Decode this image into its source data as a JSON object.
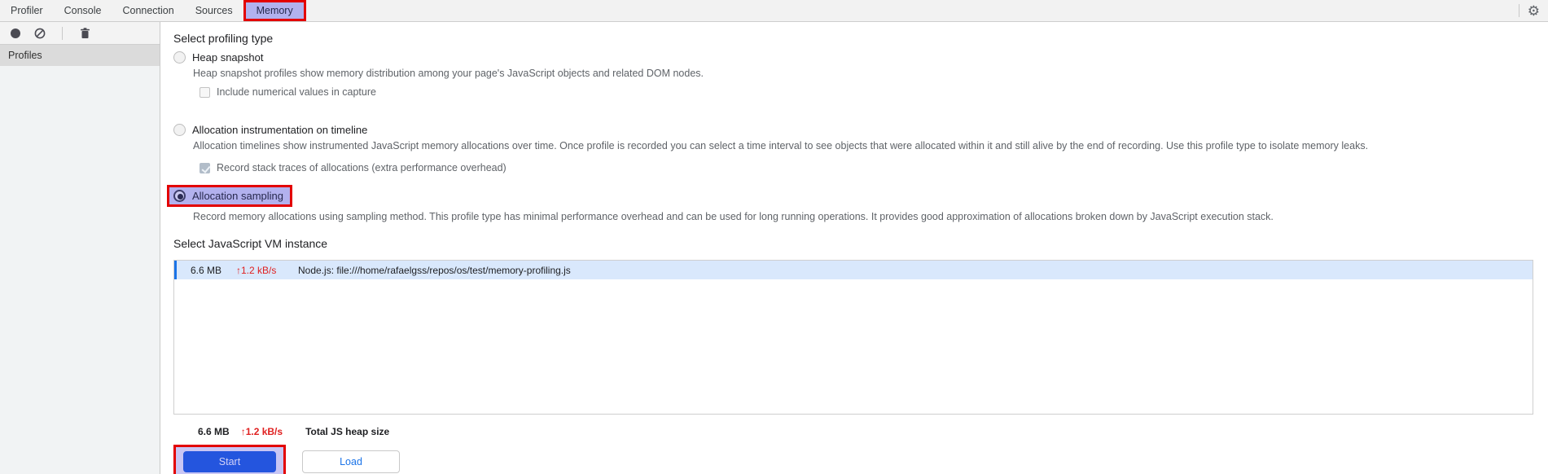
{
  "tabs": {
    "items": [
      {
        "label": "Profiler"
      },
      {
        "label": "Console"
      },
      {
        "label": "Connection"
      },
      {
        "label": "Sources"
      },
      {
        "label": "Memory",
        "selected": true,
        "annotated": true
      }
    ]
  },
  "sidebar": {
    "header": "Profiles"
  },
  "profiling": {
    "heading": "Select profiling type",
    "types": [
      {
        "label": "Heap snapshot",
        "selected": false,
        "description": "Heap snapshot profiles show memory distribution among your page's JavaScript objects and related DOM nodes.",
        "checkbox": {
          "label": "Include numerical values in capture",
          "checked": false
        }
      },
      {
        "label": "Allocation instrumentation on timeline",
        "selected": false,
        "description": "Allocation timelines show instrumented JavaScript memory allocations over time. Once profile is recorded you can select a time interval to see objects that were allocated within it and still alive by the end of recording. Use this profile type to isolate memory leaks.",
        "checkbox": {
          "label": "Record stack traces of allocations (extra performance overhead)",
          "checked": true,
          "disabled": true
        }
      },
      {
        "label": "Allocation sampling",
        "selected": true,
        "annotated": true,
        "description": "Record memory allocations using sampling method. This profile type has minimal performance overhead and can be used for long running operations. It provides good approximation of allocations broken down by JavaScript execution stack."
      }
    ]
  },
  "vm": {
    "heading": "Select JavaScript VM instance",
    "instances": [
      {
        "size": "6.6 MB",
        "delta": "↑1.2 kB/s",
        "name": "Node.js: file:///home/rafaelgss/repos/os/test/memory-profiling.js",
        "selected": true
      }
    ],
    "total": {
      "size": "6.6 MB",
      "delta": "↑1.2 kB/s",
      "label": "Total JS heap size"
    }
  },
  "actions": {
    "start": "Start",
    "load": "Load"
  },
  "icons": [
    "record-icon",
    "clear-all-icon",
    "delete-profile-icon",
    "settings-gear-icon"
  ],
  "colors": {
    "annotation_red": "#e30000",
    "annotation_lavender": "#b2b1ee",
    "accent_blue": "#1a73e8",
    "start_button_blue": "#2455de",
    "delta_red": "#e02020",
    "selected_row_bg": "#d9e8fc"
  }
}
